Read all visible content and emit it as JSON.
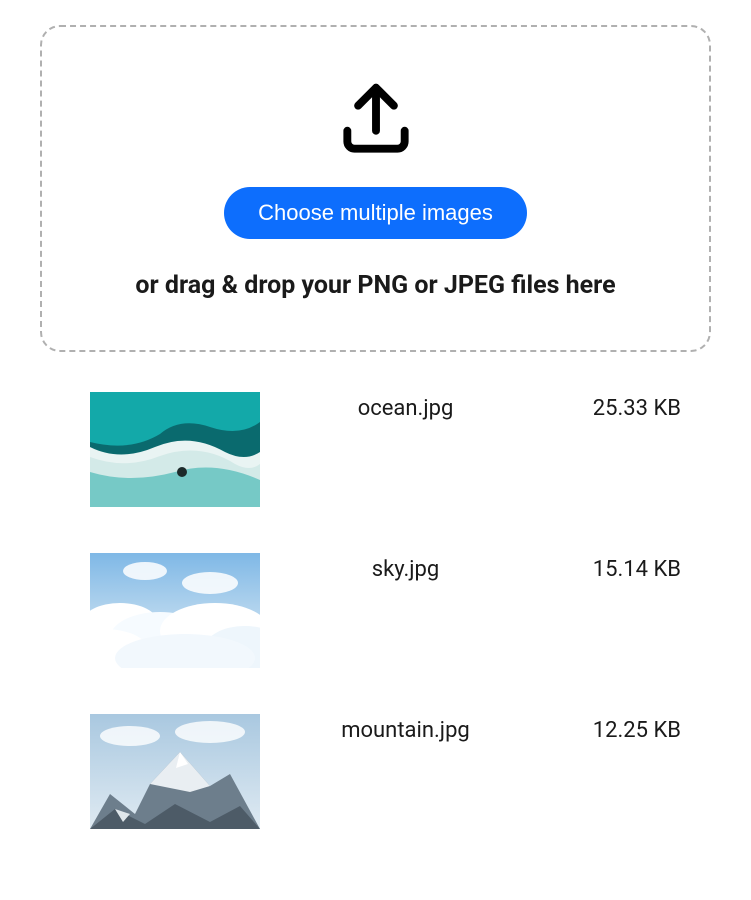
{
  "dropzone": {
    "button_label": "Choose multiple images",
    "drag_text": "or drag & drop your PNG or JPEG files here"
  },
  "files": [
    {
      "name": "ocean.jpg",
      "size": "25.33 KB",
      "thumb_kind": "ocean"
    },
    {
      "name": "sky.jpg",
      "size": "15.14 KB",
      "thumb_kind": "sky"
    },
    {
      "name": "mountain.jpg",
      "size": "12.25 KB",
      "thumb_kind": "mountain"
    }
  ]
}
